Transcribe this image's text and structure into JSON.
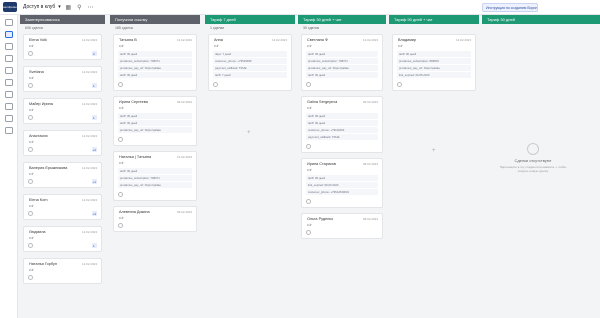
{
  "app": {
    "logo": "sendpulse",
    "title": "Доступ в клуб",
    "notice": "Инструкция по созданию Воронки"
  },
  "columns": [
    {
      "title": "Заинтересовались",
      "color": "#60626b",
      "count": "606 сделок",
      "sum": ""
    },
    {
      "title": "Получили ссылку",
      "color": "#60626b",
      "count": "185 сделок",
      "sum": ""
    },
    {
      "title": "Тариф 7 дней",
      "color": "#1d9a74",
      "count": "1 сделки",
      "sum": "35"
    },
    {
      "title": "Тариф 30 дней + чат",
      "color": "#1d9a74",
      "count": "30 сделок",
      "sum": ""
    },
    {
      "title": "Тариф 90 дней + чат",
      "color": "#1d9a74",
      "count": "",
      "sum": ""
    },
    {
      "title": "Тариф 30 дней",
      "color": "#1d9a74",
      "count": "",
      "sum": ""
    }
  ],
  "col1": [
    {
      "name": "Elena Volk",
      "date": "12.02.2023",
      "price": "0 ₽",
      "act": "2"
    },
    {
      "name": "Svetlana",
      "date": "12.02.2023",
      "price": "0 ₽",
      "act": "1"
    },
    {
      "name": "Майер Ирина",
      "date": "12.02.2023",
      "price": "0 ₽",
      "act": "1"
    },
    {
      "name": "Анастасия",
      "date": "12.02.2023",
      "price": "0 ₽",
      "act": "+2"
    },
    {
      "name": "Валерия Ерыжникова",
      "date": "12.02.2023",
      "price": "0 ₽",
      "act": "+1"
    },
    {
      "name": "Elena Kom",
      "date": "12.02.2023",
      "price": "0 ₽",
      "act": "+3"
    },
    {
      "name": "Людмила",
      "date": "12.02.2023",
      "price": "0 ₽",
      "act": "1"
    },
    {
      "name": "Наталья Горбун",
      "date": "12.02.2023",
      "price": "0 ₽",
      "act": ""
    }
  ],
  "col2": [
    {
      "name": "Татьяна В",
      "date": "13.02.2023",
      "price": "0 ₽",
      "tags": [
        "tariff: 30 дней",
        "prodamus_subscription: 798371",
        "prodamus_pay_url: https://palata",
        "tariff: 30 дней"
      ]
    },
    {
      "name": "Ирина Сергеева",
      "date": "09.02.2023",
      "price": "0 ₽",
      "tags": [
        "tariff: 30 дней",
        "tariff: 30 дней",
        "prodamus_pay_url: https://palata"
      ]
    },
    {
      "name": "Наталья | Татьяна",
      "date": "13.02.2023",
      "price": "0 ₽",
      "tags": [
        "tariff: 30 дней",
        "prodamus_subscription: 798371",
        "prodamus_pay_url: https://palata"
      ]
    },
    {
      "name": "Алевтина Дикина",
      "date": "09.02.2023",
      "price": "0 ₽",
      "tags": []
    }
  ],
  "col3": [
    {
      "name": "Анна",
      "date": "13.02.2023",
      "price": "0 ₽",
      "tags": [
        "days: 7 дней",
        "customer_phone: +79533069",
        "payment_callback: TRUE",
        "tariff: 7 дней"
      ]
    }
  ],
  "col4": [
    {
      "name": "Светлана Ф",
      "date": "13.02.2023",
      "price": "0 ₽",
      "tags": [
        "tariff: 30 дней",
        "prodamus_subscription: 798371",
        "prodamus_pay_url: https://palata",
        "tariff: 30 дней"
      ]
    },
    {
      "name": "Galina Sergeyeva",
      "date": "09.02.2023",
      "price": "0 ₽",
      "tags": [
        "tariff: 30 дней",
        "tariff: 30 дней",
        "customer_phone: +79116253",
        "payment_callback: TRUE"
      ]
    },
    {
      "name": "Ирина Стариков",
      "date": "08.02.2023",
      "price": "0 ₽",
      "tags": [
        "tariff: 30 дней",
        "link_expired: 09.03.2023",
        "customer_phone: +79512630001"
      ]
    },
    {
      "name": "Ольга Руденко",
      "date": "08.02.2023",
      "price": "0 ₽",
      "tags": []
    }
  ],
  "col5": [
    {
      "name": "Владимир",
      "date": "13.02.2023",
      "price": "0 ₽",
      "tags": [
        "tariff: 90 дней",
        "prodamus_subscription: 899803",
        "prodamus_pay_url: https://palata",
        "link_expired: 09.05.2023"
      ]
    }
  ],
  "empty": {
    "title": "Сделки отсутствуют",
    "desc": "Перетащите в эту стадию или нажмите + чтобы создать новую сделку"
  }
}
